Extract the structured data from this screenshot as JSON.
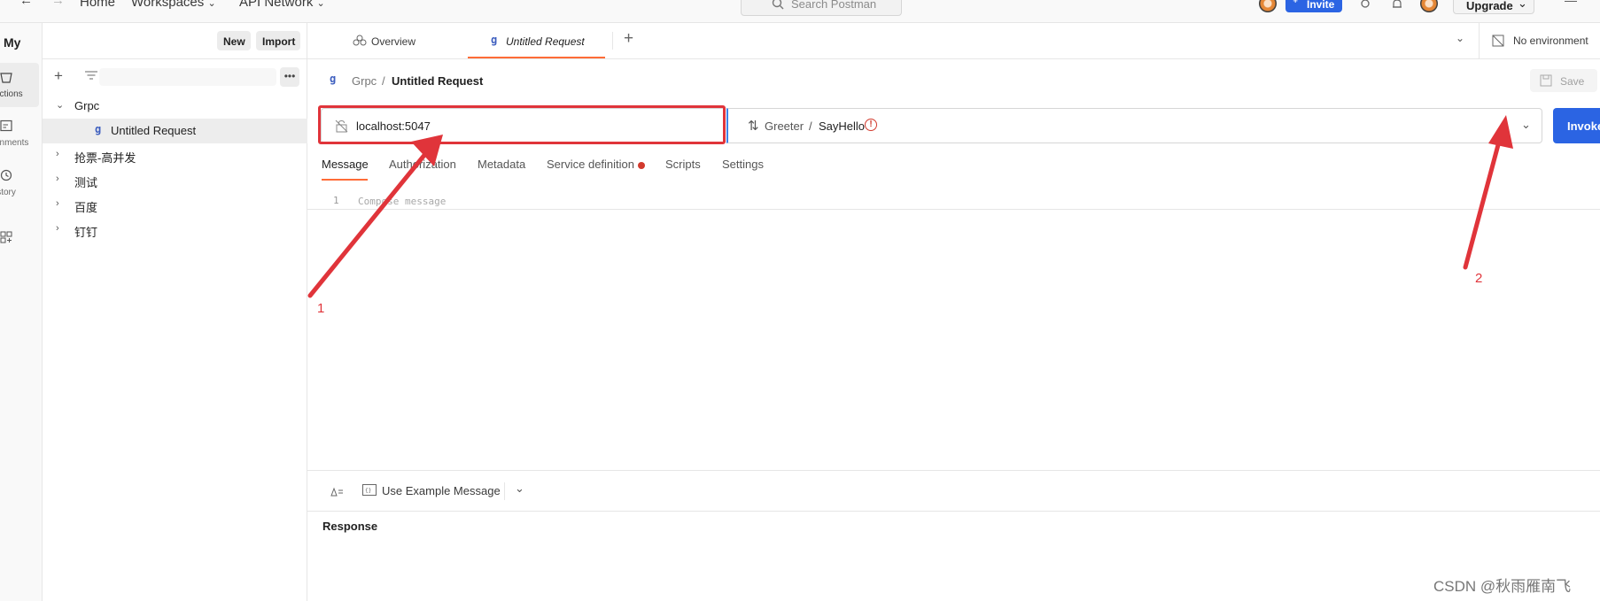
{
  "topbar": {
    "home": "Home",
    "workspaces": "Workspaces",
    "api_network": "API Network",
    "search_placeholder": "Search Postman",
    "invite": "Invite",
    "upgrade": "Upgrade"
  },
  "rail": {
    "items": [
      {
        "label": "ections"
      },
      {
        "label": "onments"
      },
      {
        "label": "istory"
      }
    ]
  },
  "sidebar": {
    "workspace": "My",
    "new_label": "New",
    "import_label": "Import",
    "tree": [
      {
        "label": "Grpc",
        "expanded": true
      },
      {
        "label": "Untitled Request",
        "selected": true
      },
      {
        "label": "抢票-高并发"
      },
      {
        "label": "测试"
      },
      {
        "label": "百度"
      },
      {
        "label": "钉钉"
      }
    ]
  },
  "tabs": {
    "overview": "Overview",
    "untitled": "Untitled Request",
    "environment": "No environment"
  },
  "breadcrumb": {
    "parent": "Grpc",
    "separator": "/",
    "current": "Untitled Request",
    "save": "Save"
  },
  "request": {
    "url": "localhost:5047",
    "service": "Greeter",
    "method_separator": "/",
    "method": "SayHello",
    "invoke": "Invoke"
  },
  "subtabs": {
    "message": "Message",
    "authorization": "Authorization",
    "metadata": "Metadata",
    "service_definition": "Service definition",
    "scripts": "Scripts",
    "settings": "Settings"
  },
  "editor": {
    "line_number": "1",
    "placeholder": "Compose message"
  },
  "footer": {
    "use_example": "Use Example Message",
    "response": "Response"
  },
  "annotations": {
    "label_1": "1",
    "label_2": "2"
  },
  "watermark": "CSDN @秋雨雁南飞",
  "colors": {
    "accent": "#ff6c37",
    "primary": "#2b64e3",
    "annotation": "#e0343a",
    "warning": "#d23a2d"
  }
}
